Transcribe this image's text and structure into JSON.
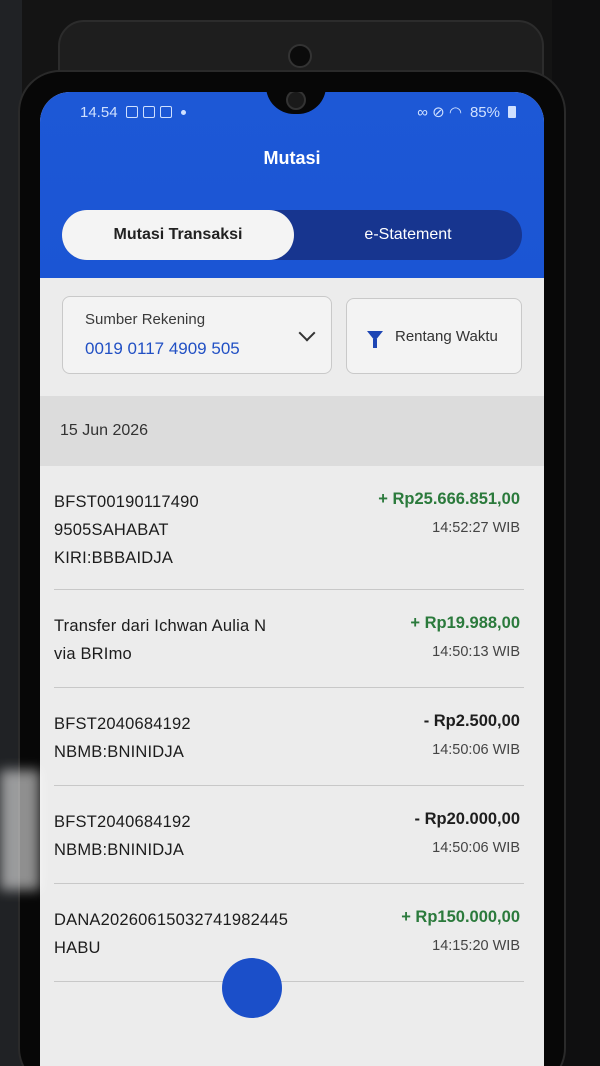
{
  "status_bar": {
    "time": "14.54",
    "battery": "85%"
  },
  "app": {
    "title": "Mutasi"
  },
  "tabs": [
    {
      "label": "Mutasi Transaksi",
      "active": true
    },
    {
      "label": "e-Statement",
      "active": false
    }
  ],
  "filters": {
    "source_label": "Sumber Rekening",
    "source_value": "0019 0117 4909 505",
    "date_filter_label": "Rentang Waktu"
  },
  "date_header": "15 Jun 2026",
  "transactions": [
    {
      "desc_line1": "BFST00190117490",
      "desc_line2": "9505SAHABAT",
      "desc_line3": "KIRI:BBBAIDJA",
      "amount": "+ Rp25.666.851,00",
      "time": "14:52:27 WIB",
      "type": "credit"
    },
    {
      "desc_line1": "Transfer dari Ichwan Aulia N",
      "desc_line2": "via BRImo",
      "desc_line3": "",
      "amount": "+ Rp19.988,00",
      "time": "14:50:13 WIB",
      "type": "credit"
    },
    {
      "desc_line1": "BFST2040684192",
      "desc_line2": "NBMB:BNINIDJA",
      "desc_line3": "",
      "amount": "- Rp2.500,00",
      "time": "14:50:06 WIB",
      "type": "debit"
    },
    {
      "desc_line1": "BFST2040684192",
      "desc_line2": "NBMB:BNINIDJA",
      "desc_line3": "",
      "amount": "- Rp20.000,00",
      "time": "14:50:06 WIB",
      "type": "debit"
    },
    {
      "desc_line1": "DANA20260615032741982445",
      "desc_line2": "HABU",
      "desc_line3": "",
      "amount": "+ Rp150.000,00",
      "time": "14:15:20 WIB",
      "type": "credit"
    }
  ],
  "colors": {
    "header_blue": "#1d58d6",
    "tab_dark": "#17358f",
    "credit_green": "#2b7a3c",
    "account_blue": "#2150c4"
  },
  "icons": [
    "chevron-down-icon",
    "filter-icon",
    "wifi-icon",
    "battery-icon"
  ]
}
